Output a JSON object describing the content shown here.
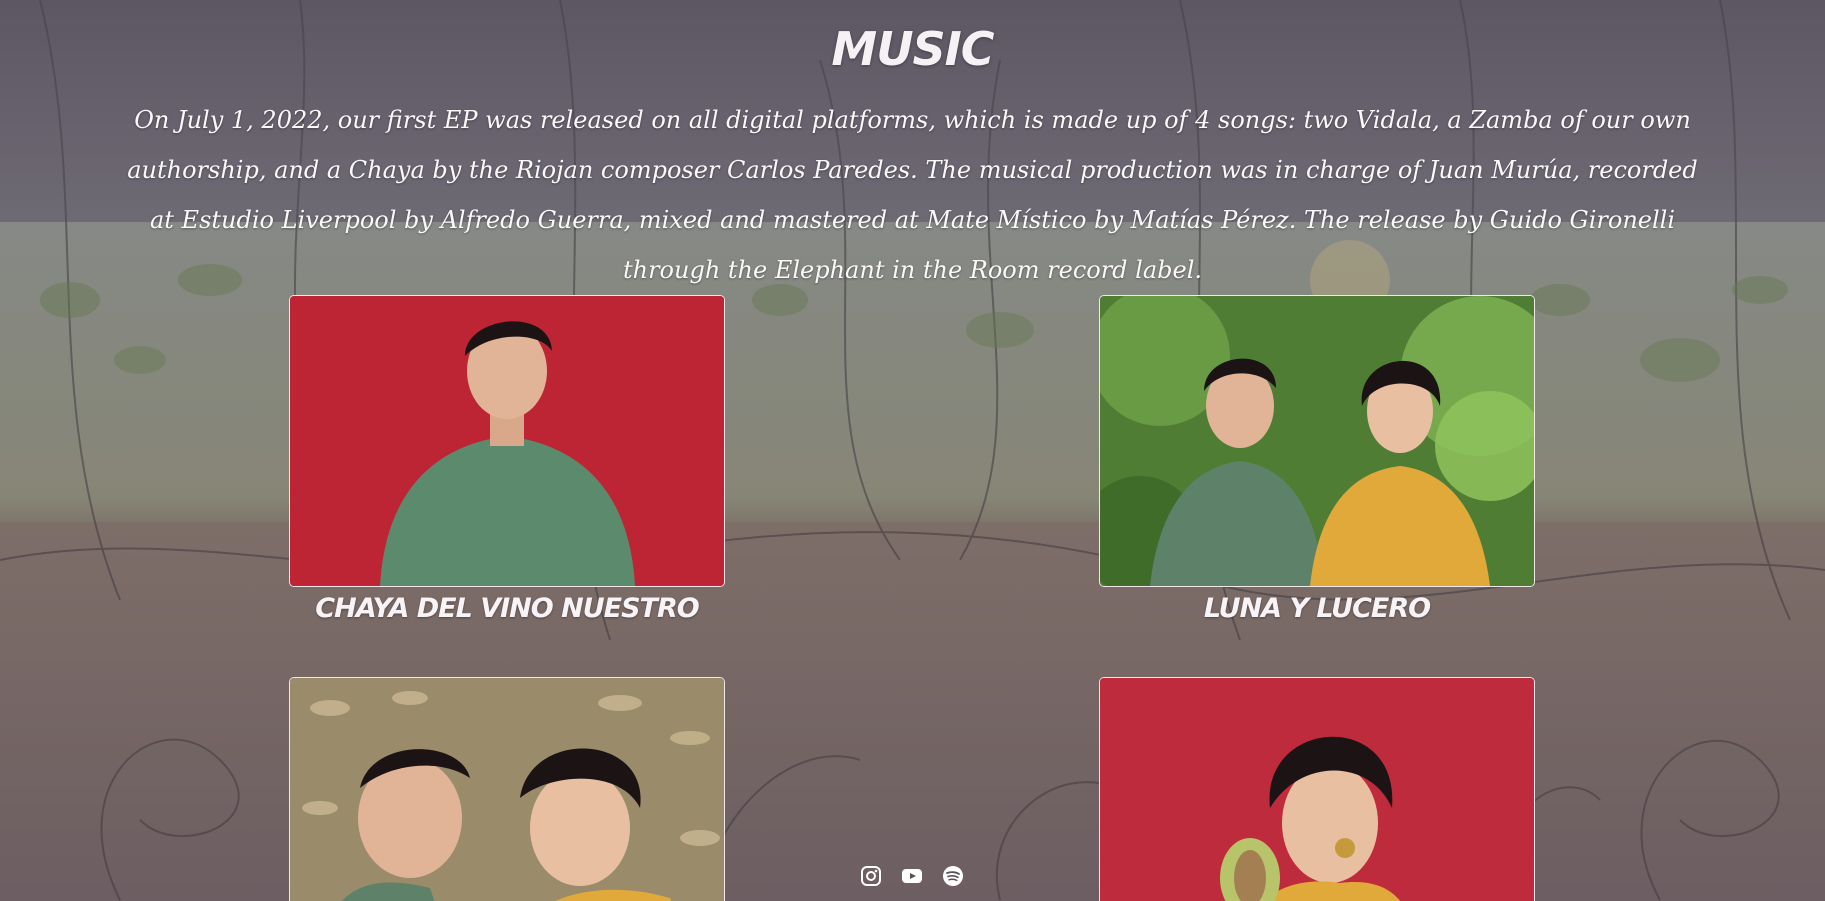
{
  "section": {
    "title": "MUSIC",
    "intro": "On July 1, 2022, our first EP was released on all digital platforms, which is made up of 4 songs: two Vidala, a Zamba of our own authorship, and a Chaya by the Riojan composer Carlos Paredes. The musical production was in charge of Juan Murúa, recorded at Estudio Liverpool by Alfredo Guerra, mixed and mastered at Mate Místico by Matías Pérez. The release by Guido Gironelli through the Elephant in the Room record label."
  },
  "songs": [
    {
      "title": "CHAYA DEL VINO NUESTRO",
      "photo": "man-green-shirt-red-wall-photo"
    },
    {
      "title": "LUNA Y LUCERO",
      "photo": "duo-among-leaves-photo"
    },
    {
      "title": "",
      "photo": "duo-lying-on-leaves-photo"
    },
    {
      "title": "",
      "photo": "woman-with-leaf-red-wall-photo"
    }
  ],
  "social": [
    {
      "name": "instagram-icon"
    },
    {
      "name": "youtube-icon"
    },
    {
      "name": "spotify-icon"
    }
  ],
  "colors": {
    "overlay": "#4e4654",
    "text": "#ffffff",
    "wall_red": "#c8283a",
    "foliage_green": "#5a8a3a"
  }
}
